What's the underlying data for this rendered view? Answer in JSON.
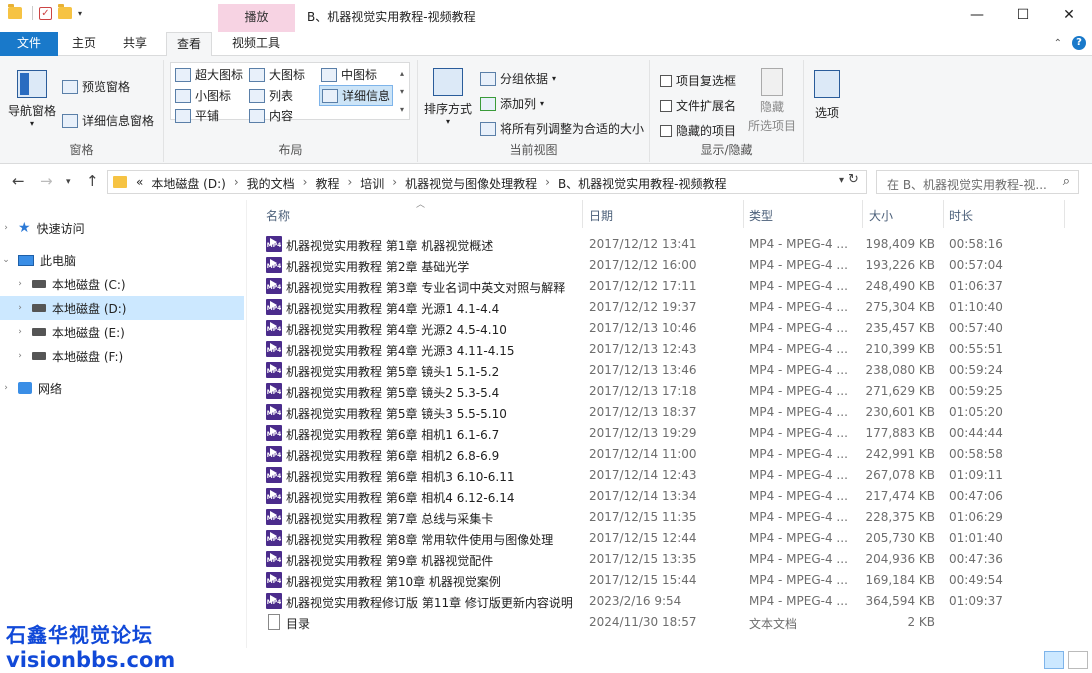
{
  "window": {
    "title": "B、机器视觉实用教程-视频教程",
    "context_tab": "播放",
    "controls": [
      "minimize",
      "maximize",
      "close"
    ]
  },
  "ribbon": {
    "tabs": [
      "文件",
      "主页",
      "共享",
      "查看",
      "视频工具"
    ],
    "active_tab": "查看",
    "groups": {
      "pane": {
        "label": "窗格",
        "nav_pane": "导航窗格",
        "preview": "预览窗格",
        "details": "详细信息窗格"
      },
      "layout": {
        "label": "布局",
        "items": [
          "超大图标",
          "大图标",
          "中图标",
          "小图标",
          "列表",
          "详细信息",
          "平铺",
          "内容"
        ],
        "selected": "详细信息"
      },
      "current_view": {
        "label": "当前视图",
        "sort": "排序方式",
        "group_by": "分组依据",
        "add_column": "添加列",
        "fit_columns": "将所有列调整为合适的大小"
      },
      "show_hide": {
        "label": "显示/隐藏",
        "item_checkbox": "项目复选框",
        "file_ext": "文件扩展名",
        "hidden_items": "隐藏的项目",
        "hide": "隐藏",
        "hide_selected": "所选项目"
      },
      "options": {
        "label": "选项"
      }
    }
  },
  "address": {
    "prefix": "«",
    "breadcrumb": [
      "本地磁盘 (D:)",
      "我的文档",
      "教程",
      "培训",
      "机器视觉与图像处理教程",
      "B、机器视觉实用教程-视频教程"
    ],
    "search_placeholder": "在 B、机器视觉实用教程-视..."
  },
  "nav_pane": {
    "quick_access": "快速访问",
    "this_pc": "此电脑",
    "drives": [
      "本地磁盘 (C:)",
      "本地磁盘 (D:)",
      "本地磁盘 (E:)",
      "本地磁盘 (F:)"
    ],
    "selected_drive": "本地磁盘 (D:)",
    "network": "网络"
  },
  "columns": [
    "名称",
    "日期",
    "类型",
    "大小",
    "时长"
  ],
  "files": [
    {
      "name": "机器视觉实用教程 第1章 机器视觉概述",
      "date": "2017/12/12 13:41",
      "type": "MP4 - MPEG-4 ...",
      "size": "198,409 KB",
      "duration": "00:58:16",
      "icon": "mp4"
    },
    {
      "name": "机器视觉实用教程 第2章 基础光学",
      "date": "2017/12/12 16:00",
      "type": "MP4 - MPEG-4 ...",
      "size": "193,226 KB",
      "duration": "00:57:04",
      "icon": "mp4"
    },
    {
      "name": "机器视觉实用教程 第3章 专业名词中英文对照与解释",
      "date": "2017/12/12 17:11",
      "type": "MP4 - MPEG-4 ...",
      "size": "248,490 KB",
      "duration": "01:06:37",
      "icon": "mp4"
    },
    {
      "name": "机器视觉实用教程 第4章 光源1 4.1-4.4",
      "date": "2017/12/12 19:37",
      "type": "MP4 - MPEG-4 ...",
      "size": "275,304 KB",
      "duration": "01:10:40",
      "icon": "mp4"
    },
    {
      "name": "机器视觉实用教程 第4章 光源2 4.5-4.10",
      "date": "2017/12/13 10:46",
      "type": "MP4 - MPEG-4 ...",
      "size": "235,457 KB",
      "duration": "00:57:40",
      "icon": "mp4"
    },
    {
      "name": "机器视觉实用教程 第4章 光源3 4.11-4.15",
      "date": "2017/12/13 12:43",
      "type": "MP4 - MPEG-4 ...",
      "size": "210,399 KB",
      "duration": "00:55:51",
      "icon": "mp4"
    },
    {
      "name": "机器视觉实用教程 第5章 镜头1 5.1-5.2",
      "date": "2017/12/13 13:46",
      "type": "MP4 - MPEG-4 ...",
      "size": "238,080 KB",
      "duration": "00:59:24",
      "icon": "mp4"
    },
    {
      "name": "机器视觉实用教程 第5章 镜头2 5.3-5.4",
      "date": "2017/12/13 17:18",
      "type": "MP4 - MPEG-4 ...",
      "size": "271,629 KB",
      "duration": "00:59:25",
      "icon": "mp4"
    },
    {
      "name": "机器视觉实用教程 第5章 镜头3 5.5-5.10",
      "date": "2017/12/13 18:37",
      "type": "MP4 - MPEG-4 ...",
      "size": "230,601 KB",
      "duration": "01:05:20",
      "icon": "mp4"
    },
    {
      "name": "机器视觉实用教程 第6章 相机1 6.1-6.7",
      "date": "2017/12/13 19:29",
      "type": "MP4 - MPEG-4 ...",
      "size": "177,883 KB",
      "duration": "00:44:44",
      "icon": "mp4"
    },
    {
      "name": "机器视觉实用教程 第6章 相机2 6.8-6.9",
      "date": "2017/12/14 11:00",
      "type": "MP4 - MPEG-4 ...",
      "size": "242,991 KB",
      "duration": "00:58:58",
      "icon": "mp4"
    },
    {
      "name": "机器视觉实用教程 第6章 相机3 6.10-6.11",
      "date": "2017/12/14 12:43",
      "type": "MP4 - MPEG-4 ...",
      "size": "267,078 KB",
      "duration": "01:09:11",
      "icon": "mp4"
    },
    {
      "name": "机器视觉实用教程 第6章 相机4 6.12-6.14",
      "date": "2017/12/14 13:34",
      "type": "MP4 - MPEG-4 ...",
      "size": "217,474 KB",
      "duration": "00:47:06",
      "icon": "mp4"
    },
    {
      "name": "机器视觉实用教程 第7章 总线与采集卡",
      "date": "2017/12/15 11:35",
      "type": "MP4 - MPEG-4 ...",
      "size": "228,375 KB",
      "duration": "01:06:29",
      "icon": "mp4"
    },
    {
      "name": "机器视觉实用教程 第8章 常用软件使用与图像处理",
      "date": "2017/12/15 12:44",
      "type": "MP4 - MPEG-4 ...",
      "size": "205,730 KB",
      "duration": "01:01:40",
      "icon": "mp4"
    },
    {
      "name": "机器视觉实用教程 第9章 机器视觉配件",
      "date": "2017/12/15 13:35",
      "type": "MP4 - MPEG-4 ...",
      "size": "204,936 KB",
      "duration": "00:47:36",
      "icon": "mp4"
    },
    {
      "name": "机器视觉实用教程 第10章 机器视觉案例",
      "date": "2017/12/15 15:44",
      "type": "MP4 - MPEG-4 ...",
      "size": "169,184 KB",
      "duration": "00:49:54",
      "icon": "mp4"
    },
    {
      "name": "机器视觉实用教程修订版 第11章 修订版更新内容说明",
      "date": "2023/2/16 9:54",
      "type": "MP4 - MPEG-4 ...",
      "size": "364,594 KB",
      "duration": "01:09:37",
      "icon": "mp4"
    },
    {
      "name": "目录",
      "date": "2024/11/30 18:57",
      "type": "文本文档",
      "size": "2 KB",
      "duration": "",
      "icon": "txt"
    }
  ],
  "watermark": {
    "line1": "石鑫华视觉论坛",
    "line2": "visionbbs.com"
  },
  "colors": {
    "file_tab": "#1979ca",
    "context_tab": "#f7d3e3",
    "selection": "#cce8ff",
    "watermark": "#1149d8",
    "mp4_icon": "#4b2c8c"
  }
}
